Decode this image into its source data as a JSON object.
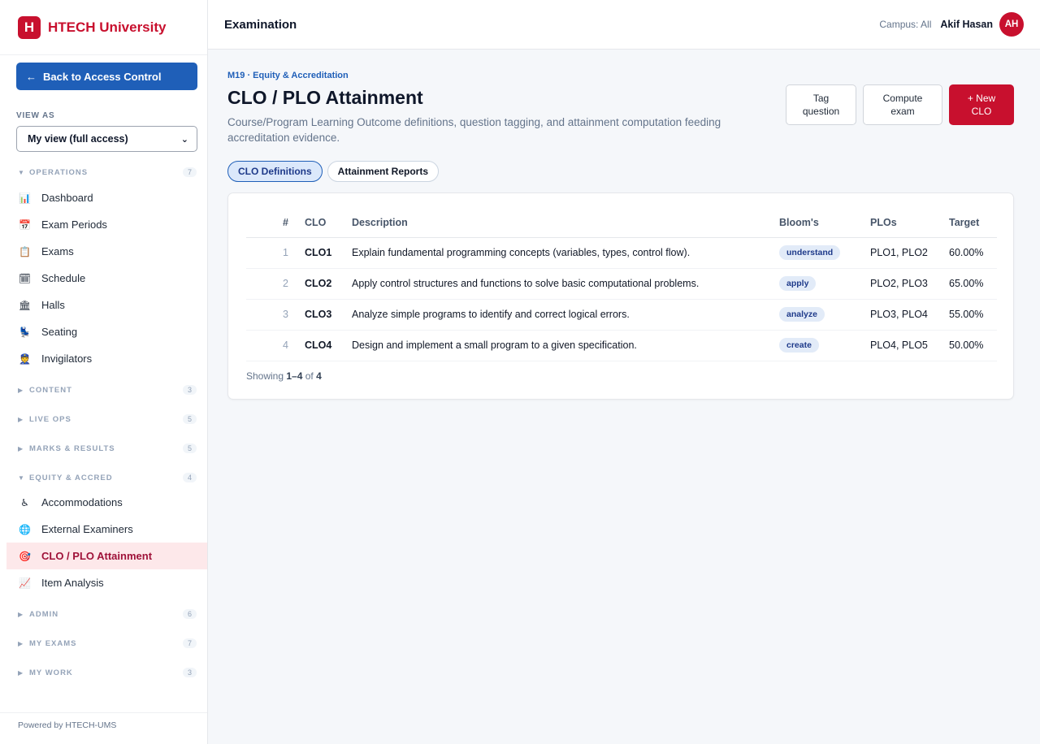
{
  "brand": {
    "logo_letter": "H",
    "name": "HTECH University"
  },
  "sidebar": {
    "back_button": {
      "arrow": "←",
      "label": "Back to Access Control"
    },
    "view_as_label": "VIEW AS",
    "view_as_value": "My view (full access)",
    "groups": {
      "operations": {
        "name": "OPERATIONS",
        "count": "7",
        "expanded": true
      },
      "content": {
        "name": "CONTENT",
        "count": "3",
        "expanded": false
      },
      "live_ops": {
        "name": "LIVE OPS",
        "count": "5",
        "expanded": false
      },
      "marks": {
        "name": "MARKS & RESULTS",
        "count": "5",
        "expanded": false
      },
      "equity": {
        "name": "EQUITY & ACCRED",
        "count": "4",
        "expanded": true
      },
      "admin": {
        "name": "ADMIN",
        "count": "6",
        "expanded": false
      },
      "my_exams": {
        "name": "MY EXAMS",
        "count": "7",
        "expanded": false
      },
      "my_work": {
        "name": "MY WORK",
        "count": "3",
        "expanded": false
      }
    },
    "items": {
      "dashboard": {
        "label": "Dashboard",
        "icon": "📊"
      },
      "exam_periods": {
        "label": "Exam Periods",
        "icon": "📅"
      },
      "exams": {
        "label": "Exams",
        "icon": "📋"
      },
      "schedule": {
        "label": "Schedule",
        "icon": "🗓"
      },
      "halls": {
        "label": "Halls",
        "icon": "🏛"
      },
      "seating": {
        "label": "Seating",
        "icon": "💺"
      },
      "invigilators": {
        "label": "Invigilators",
        "icon": "👮"
      },
      "accommodations": {
        "label": "Accommodations",
        "icon": "♿"
      },
      "external_examiners": {
        "label": "External Examiners",
        "icon": "🌐"
      },
      "clo_plo": {
        "label": "CLO / PLO Attainment",
        "icon": "🎯"
      },
      "item_analysis": {
        "label": "Item Analysis",
        "icon": "📈"
      }
    },
    "footer": "Powered by HTECH-UMS"
  },
  "header": {
    "title": "Examination",
    "campus": "Campus: All",
    "user_name": "Akif Hasan",
    "avatar_initials": "AH"
  },
  "page": {
    "module": "M19 · Equity & Accreditation",
    "title": "CLO / PLO Attainment",
    "description": "Course/Program Learning Outcome definitions, question tagging, and attainment computation feeding accreditation evidence.",
    "actions": {
      "tag_question": "Tag question",
      "compute_exam": "Compute exam",
      "new_clo": "+ New CLO"
    },
    "tabs": {
      "definitions": "CLO Definitions",
      "reports": "Attainment Reports"
    }
  },
  "table": {
    "headers": {
      "num": "#",
      "clo": "CLO",
      "description": "Description",
      "bloom": "Bloom's",
      "plos": "PLOs",
      "target": "Target"
    },
    "rows": [
      {
        "num": "1",
        "clo": "CLO1",
        "description": "Explain fundamental programming concepts (variables, types, control flow).",
        "bloom": "understand",
        "plos": "PLO1, PLO2",
        "target": "60.00%"
      },
      {
        "num": "2",
        "clo": "CLO2",
        "description": "Apply control structures and functions to solve basic computational problems.",
        "bloom": "apply",
        "plos": "PLO2, PLO3",
        "target": "65.00%"
      },
      {
        "num": "3",
        "clo": "CLO3",
        "description": "Analyze simple programs to identify and correct logical errors.",
        "bloom": "analyze",
        "plos": "PLO3, PLO4",
        "target": "55.00%"
      },
      {
        "num": "4",
        "clo": "CLO4",
        "description": "Design and implement a small program to a given specification.",
        "bloom": "create",
        "plos": "PLO4, PLO5",
        "target": "50.00%"
      }
    ],
    "showing": {
      "prefix": "Showing ",
      "range": "1–4",
      "of": " of ",
      "total": "4"
    }
  },
  "colors": {
    "brand_red": "#c8102e",
    "brand_blue": "#1f5fb8",
    "active_bg": "#fde8ea"
  }
}
